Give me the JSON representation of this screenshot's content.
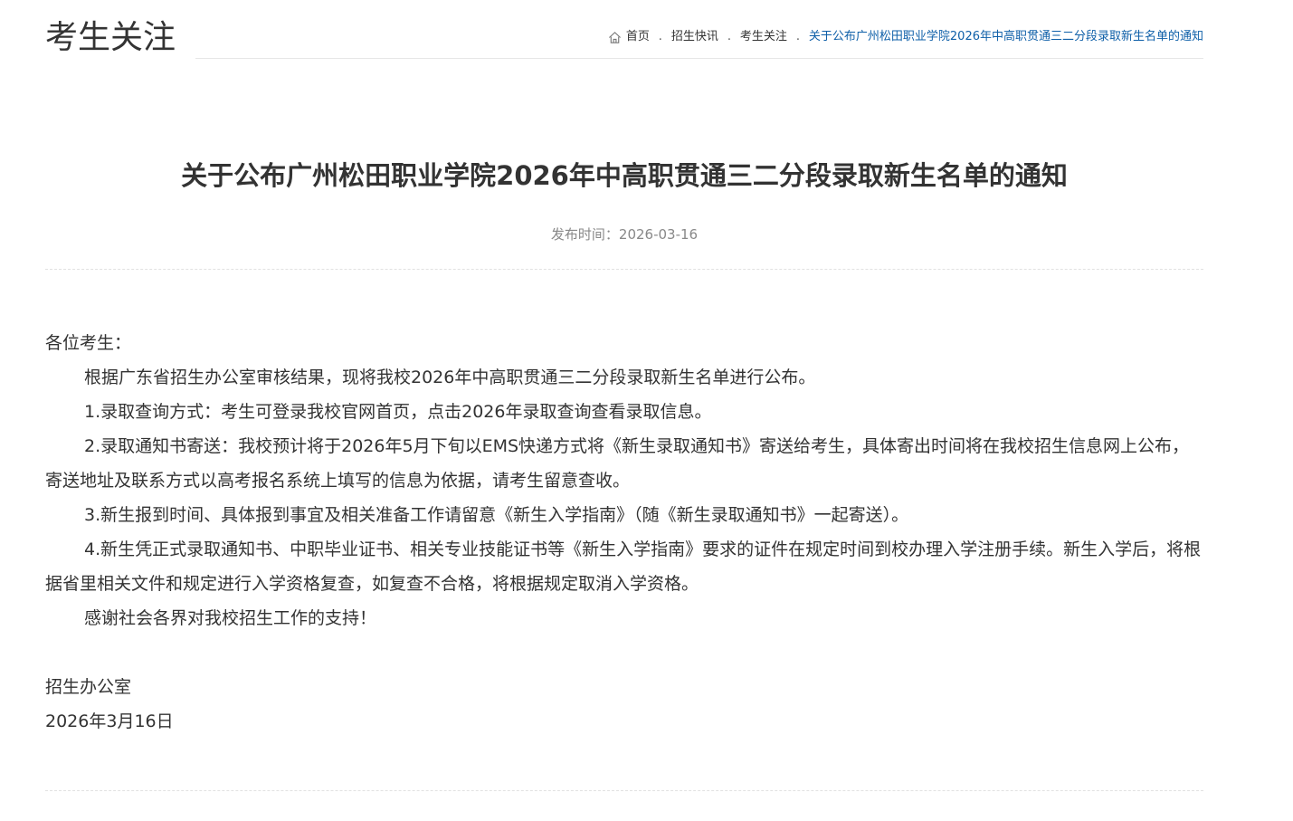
{
  "header": {
    "section_title": "考生关注",
    "breadcrumb": {
      "home": "首页",
      "items": [
        "招生快讯",
        "考生关注"
      ],
      "current": "关于公布广州松田职业学院2026年中高职贯通三二分段录取新生名单的通知",
      "separator": "."
    }
  },
  "article": {
    "title": "关于公布广州松田职业学院2026年中高职贯通三二分段录取新生名单的通知",
    "publish_time": "发布时间：2026-03-16",
    "greeting": "各位考生：",
    "paragraphs": [
      "根据广东省招生办公室审核结果，现将我校2026年中高职贯通三二分段录取新生名单进行公布。",
      "1.录取查询方式：考生可登录我校官网首页，点击2026年录取查询查看录取信息。",
      "2.录取通知书寄送：我校预计将于2026年5月下旬以EMS快递方式将《新生录取通知书》寄送给考生，具体寄出时间将在我校招生信息网上公布，寄送地址及联系方式以高考报名系统上填写的信息为依据，请考生留意查收。",
      "3.新生报到时间、具体报到事宜及相关准备工作请留意《新生入学指南》（随《新生录取通知书》一起寄送）。",
      "4.新生凭正式录取通知书、中职毕业证书、相关专业技能证书等《新生入学指南》要求的证件在规定时间到校办理入学注册手续。新生入学后，将根据省里相关文件和规定进行入学资格复查，如复查不合格，将根据规定取消入学资格。",
      "感谢社会各界对我校招生工作的支持！"
    ],
    "signature": "招生办公室",
    "date": "2026年3月16日"
  },
  "colors": {
    "text": "#333333",
    "link_current": "#0e5fa8",
    "muted": "#888888",
    "divider": "#e2e2e2"
  },
  "icons": {
    "breadcrumb_home": "home-icon"
  }
}
